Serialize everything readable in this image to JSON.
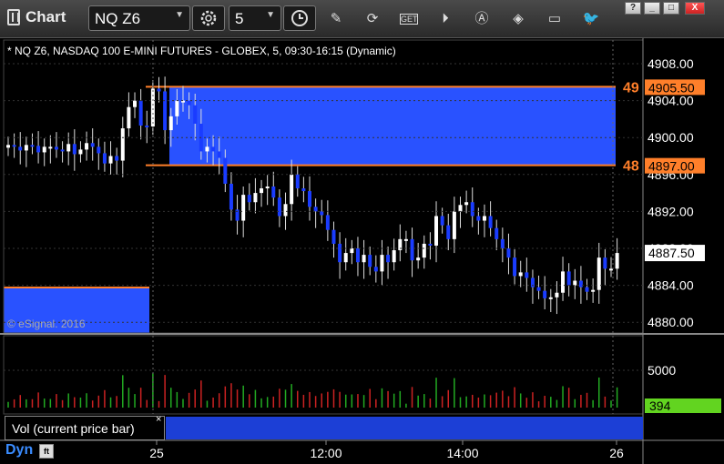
{
  "app": {
    "title": "Chart"
  },
  "toolbar": {
    "symbol": "NQ Z6",
    "interval": "5",
    "icons": [
      "settings-gear-icon",
      "clock-icon",
      "pencil-icon",
      "refresh-icon",
      "get-icon",
      "play-icon",
      "alert-icon",
      "tag-icon",
      "comment-icon",
      "twitter-icon"
    ]
  },
  "window": {
    "help": "?",
    "minimize": "_",
    "maximize": "□",
    "close": "X"
  },
  "chart": {
    "header": "* NQ Z6, NASDAQ 100 E-MINI FUTURES - GLOBEX, 5, 09:30-16:15 (Dynamic)",
    "watermark": "© eSignal. 2016",
    "colors": {
      "up": "#ffffff",
      "down": "#1a3cff",
      "zone": "#2952ff",
      "level": "#ff7f2a",
      "vol_up": "#22aa22",
      "vol_down": "#cc2222",
      "last_price_badge": "#62d420"
    }
  },
  "chart_data": [
    {
      "type": "candlestick",
      "title": "",
      "ylim": [
        4878,
        4911
      ],
      "y_ticks": [
        "4908.00",
        "4904.00",
        "4900.00",
        "4896.00",
        "4892.00",
        "4888.00",
        "4884.00",
        "4880.00"
      ],
      "x_ticks": [
        "25",
        "12:00",
        "14:00",
        "26"
      ],
      "levels": [
        {
          "label": "49",
          "price_label": "4905.50",
          "value": 4905.5
        },
        {
          "label": "48",
          "price_label": "4897.00",
          "value": 4897.0
        }
      ],
      "last_price": {
        "label": "4887.50",
        "value": 4887.5
      },
      "zones": [
        {
          "name": "upper-zone",
          "top": 4905.5,
          "bottom": 4897.0,
          "start_bar": 23,
          "end_bar": 92
        }
      ],
      "close": [
        4899.2,
        4899.0,
        4898.6,
        4899.2,
        4899.1,
        4898.4,
        4899.0,
        4899.0,
        4898.7,
        4898.5,
        4899.3,
        4898.2,
        4898.7,
        4899.4,
        4899.0,
        4898.3,
        4897.2,
        4898.0,
        4897.5,
        4901.0,
        4903.3,
        4904.0,
        4901.3,
        4901.2,
        4905.3,
        4905.0,
        4900.8,
        4902.3,
        4904.0,
        4904.0,
        4903.5,
        4901.5,
        4898.5,
        4899.0,
        4898.5,
        4897.8,
        4895.0,
        4892.2,
        4891.0,
        4893.8,
        4893.0,
        4894.0,
        4894.5,
        4894.7,
        4893.5,
        4891.5,
        4892.8,
        4896.0,
        4894.5,
        4894.2,
        4892.5,
        4892.0,
        4891.6,
        4890.0,
        4888.5,
        4886.5,
        4887.5,
        4888.0,
        4886.5,
        4887.3,
        4886.0,
        4885.5,
        4887.3,
        4886.5,
        4887.8,
        4889.0,
        4889.0,
        4886.7,
        4887.0,
        4888.5,
        4888.3,
        4891.5,
        4890.5,
        4889.0,
        4892.0,
        4892.7,
        4893.0,
        4891.5,
        4891.0,
        4891.5,
        4890.2,
        4889.0,
        4888.0,
        4887.0,
        4885.0,
        4885.4,
        4884.8,
        4883.8,
        4883.4,
        4882.6,
        4882.7,
        4883.2,
        4885.5,
        4884.0,
        4884.5,
        4883.8,
        4883.3,
        4883.5,
        4887.0,
        4885.8,
        4885.8,
        4887.5
      ],
      "volume_max_label": "5000",
      "last_volume_label": "394"
    }
  ],
  "volume_panel": {
    "label": "Vol (current price bar)",
    "close_glyph": "×"
  },
  "footer": {
    "mode": "Dyn",
    "lock": "ft"
  }
}
